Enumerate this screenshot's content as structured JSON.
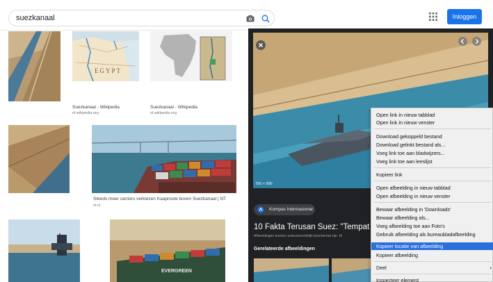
{
  "search": {
    "query": "suezkanaal"
  },
  "header": {
    "login_label": "Inloggen"
  },
  "icons": {
    "camera": "camera-icon",
    "search": "search-icon",
    "apps": "apps-grid-icon"
  },
  "results": [
    {
      "title": "Suezkanaal - Wikipedia",
      "source": "nl.wikipedia.org"
    },
    {
      "title": "Suezkanaal - Wikipedia",
      "source": "nl.wikipedia.org"
    },
    {
      "title": "Steeds meer carriers verkiezen Kaaproute boven Suezkanaal | NT",
      "source": "nt.nl"
    }
  ],
  "map_label": "EGYPT",
  "ship_label": "EVERGREEN",
  "preview": {
    "dimensions": "750 × 500",
    "source_name": "Kompas Internasional",
    "title": "10 Fakta Terusan Suez: \"Tempat L",
    "copyright": "Afbeeldingen kunnen auteursrechtelijk beschermd zijn. M",
    "related_heading": "Gerelateerde afbeeldingen"
  },
  "context_menu": {
    "items": [
      "Open link in nieuw tabblad",
      "Open link in nieuw venster",
      "Download gekoppeld bestand",
      "Download gelinkt bestand als...",
      "Voeg link toe aan bladwijzers...",
      "Voeg link toe aan leeslijst",
      "Kopieer link",
      "Open afbeelding in nieuw tabblad",
      "Open afbeelding in nieuw venster",
      "Bewaar afbeelding in 'Downloads'",
      "Bewaar afbeelding als...",
      "Voeg afbeelding toe aan Foto's",
      "Gebruik afbeelding als bureaubladafbeelding",
      "Kopieer locatie van afbeelding",
      "Kopieer afbeelding",
      "Deel",
      "Inspecteer element"
    ],
    "highlighted": "Kopieer locatie van afbeelding",
    "submenu_arrow": "›"
  },
  "colors": {
    "accent": "#1a73e8",
    "highlight": "#2a6fdb",
    "panel_bg": "#202124"
  }
}
